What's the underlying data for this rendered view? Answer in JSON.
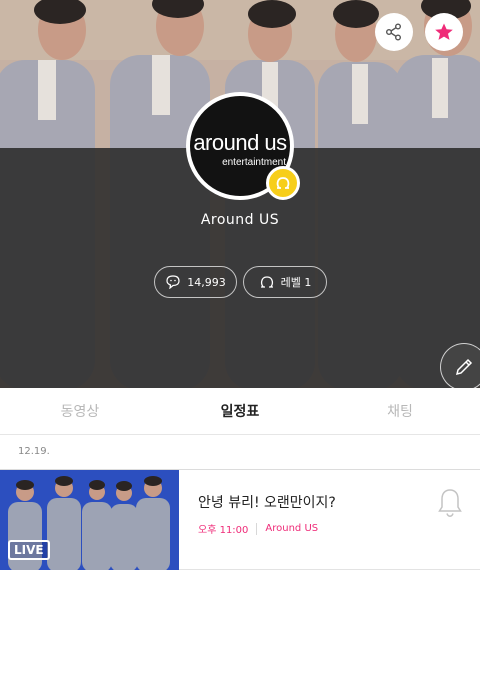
{
  "header": {
    "channel_name": "Around US",
    "logo_text": "around us",
    "logo_subtext": "entertaintment",
    "stats": {
      "fans": "14,993",
      "level": "레벨 1"
    },
    "icons": [
      "share-icon",
      "star-icon",
      "pencil-icon",
      "fan-icon",
      "level-icon"
    ]
  },
  "tabs": [
    {
      "label": "동영상",
      "active": false
    },
    {
      "label": "일정표",
      "active": true
    },
    {
      "label": "채팅",
      "active": false
    }
  ],
  "schedule": {
    "date": "12.19.",
    "items": [
      {
        "title": "안녕 뷰리! 오랜만이지?",
        "time": "오후 11:00",
        "channel": "Around US",
        "badge": "LIVE"
      }
    ]
  },
  "colors": {
    "accent": "#ef2b78",
    "level_badge": "#f7ce1a",
    "overlay": "#282828",
    "thumb_bg": "#2c4fbf"
  }
}
